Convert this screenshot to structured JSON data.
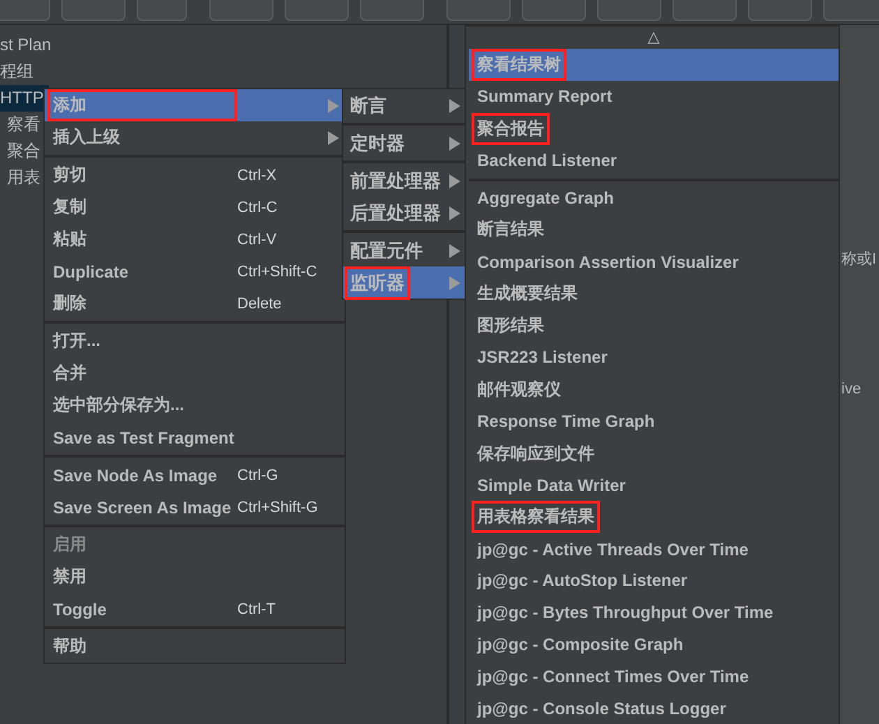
{
  "tree": {
    "items": [
      {
        "label": "st Plan",
        "selected": false
      },
      {
        "label": "程组",
        "selected": false
      },
      {
        "label": "HTTP",
        "selected": true
      },
      {
        "label": "察看",
        "selected": false
      },
      {
        "label": "聚合",
        "selected": false
      },
      {
        "label": "用表",
        "selected": false
      }
    ]
  },
  "right_panel": {
    "texts": [
      "称或I",
      "ive"
    ]
  },
  "context_menu": {
    "items": [
      {
        "kind": "item",
        "label": "添加",
        "submenu": true,
        "selected": true,
        "annotated": true,
        "disabled": false
      },
      {
        "kind": "item",
        "label": "插入上级",
        "submenu": true,
        "selected": false,
        "annotated": false,
        "disabled": false
      },
      {
        "kind": "separator"
      },
      {
        "kind": "item",
        "label": "剪切",
        "shortcut": "Ctrl-X",
        "selected": false,
        "annotated": false,
        "disabled": false
      },
      {
        "kind": "item",
        "label": "复制",
        "shortcut": "Ctrl-C",
        "selected": false,
        "annotated": false,
        "disabled": false
      },
      {
        "kind": "item",
        "label": "粘贴",
        "shortcut": "Ctrl-V",
        "selected": false,
        "annotated": false,
        "disabled": false
      },
      {
        "kind": "item",
        "label": "Duplicate",
        "shortcut": "Ctrl+Shift-C",
        "selected": false,
        "annotated": false,
        "disabled": false
      },
      {
        "kind": "item",
        "label": "删除",
        "shortcut": "Delete",
        "selected": false,
        "annotated": false,
        "disabled": false
      },
      {
        "kind": "separator"
      },
      {
        "kind": "item",
        "label": "打开...",
        "selected": false,
        "annotated": false,
        "disabled": false
      },
      {
        "kind": "item",
        "label": "合并",
        "selected": false,
        "annotated": false,
        "disabled": false
      },
      {
        "kind": "item",
        "label": "选中部分保存为...",
        "selected": false,
        "annotated": false,
        "disabled": false
      },
      {
        "kind": "item",
        "label": "Save as Test Fragment",
        "selected": false,
        "annotated": false,
        "disabled": false
      },
      {
        "kind": "separator"
      },
      {
        "kind": "item",
        "label": "Save Node As Image",
        "shortcut": "Ctrl-G",
        "selected": false,
        "annotated": false,
        "disabled": false
      },
      {
        "kind": "item",
        "label": "Save Screen As Image",
        "shortcut": "Ctrl+Shift-G",
        "selected": false,
        "annotated": false,
        "disabled": false
      },
      {
        "kind": "separator"
      },
      {
        "kind": "item",
        "label": "启用",
        "selected": false,
        "annotated": false,
        "disabled": true
      },
      {
        "kind": "item",
        "label": "禁用",
        "selected": false,
        "annotated": false,
        "disabled": false
      },
      {
        "kind": "item",
        "label": "Toggle",
        "shortcut": "Ctrl-T",
        "selected": false,
        "annotated": false,
        "disabled": false
      },
      {
        "kind": "separator"
      },
      {
        "kind": "item",
        "label": "帮助",
        "selected": false,
        "annotated": false,
        "disabled": false
      }
    ]
  },
  "add_submenu": {
    "items": [
      {
        "kind": "item",
        "label": "断言",
        "submenu": true,
        "selected": false,
        "annotated": false
      },
      {
        "kind": "separator"
      },
      {
        "kind": "item",
        "label": "定时器",
        "submenu": true,
        "selected": false,
        "annotated": false
      },
      {
        "kind": "separator"
      },
      {
        "kind": "item",
        "label": "前置处理器",
        "submenu": true,
        "selected": false,
        "annotated": false
      },
      {
        "kind": "item",
        "label": "后置处理器",
        "submenu": true,
        "selected": false,
        "annotated": false
      },
      {
        "kind": "separator"
      },
      {
        "kind": "item",
        "label": "配置元件",
        "submenu": true,
        "selected": false,
        "annotated": false
      },
      {
        "kind": "item",
        "label": "监听器",
        "submenu": true,
        "selected": true,
        "annotated": true
      }
    ]
  },
  "listener_submenu": {
    "scroll_up": "△",
    "items": [
      {
        "kind": "item",
        "label": "察看结果树",
        "selected": true,
        "annotated": true
      },
      {
        "kind": "item",
        "label": "Summary Report",
        "selected": false,
        "annotated": false
      },
      {
        "kind": "item",
        "label": "聚合报告",
        "selected": false,
        "annotated": true
      },
      {
        "kind": "item",
        "label": "Backend Listener",
        "selected": false,
        "annotated": false
      },
      {
        "kind": "separator"
      },
      {
        "kind": "item",
        "label": "Aggregate Graph",
        "selected": false,
        "annotated": false
      },
      {
        "kind": "item",
        "label": "断言结果",
        "selected": false,
        "annotated": false
      },
      {
        "kind": "item",
        "label": "Comparison Assertion Visualizer",
        "selected": false,
        "annotated": false
      },
      {
        "kind": "item",
        "label": "生成概要结果",
        "selected": false,
        "annotated": false
      },
      {
        "kind": "item",
        "label": "图形结果",
        "selected": false,
        "annotated": false
      },
      {
        "kind": "item",
        "label": "JSR223 Listener",
        "selected": false,
        "annotated": false
      },
      {
        "kind": "item",
        "label": "邮件观察仪",
        "selected": false,
        "annotated": false
      },
      {
        "kind": "item",
        "label": "Response Time Graph",
        "selected": false,
        "annotated": false
      },
      {
        "kind": "item",
        "label": "保存响应到文件",
        "selected": false,
        "annotated": false
      },
      {
        "kind": "item",
        "label": "Simple Data Writer",
        "selected": false,
        "annotated": false
      },
      {
        "kind": "item",
        "label": "用表格察看结果",
        "selected": false,
        "annotated": true
      },
      {
        "kind": "item",
        "label": "jp@gc - Active Threads Over Time",
        "selected": false,
        "annotated": false
      },
      {
        "kind": "item",
        "label": "jp@gc - AutoStop Listener",
        "selected": false,
        "annotated": false
      },
      {
        "kind": "item",
        "label": "jp@gc - Bytes Throughput Over Time",
        "selected": false,
        "annotated": false
      },
      {
        "kind": "item",
        "label": "jp@gc - Composite Graph",
        "selected": false,
        "annotated": false
      },
      {
        "kind": "item",
        "label": "jp@gc - Connect Times Over Time",
        "selected": false,
        "annotated": false
      },
      {
        "kind": "item",
        "label": "jp@gc - Console Status Logger",
        "selected": false,
        "annotated": false
      }
    ]
  }
}
